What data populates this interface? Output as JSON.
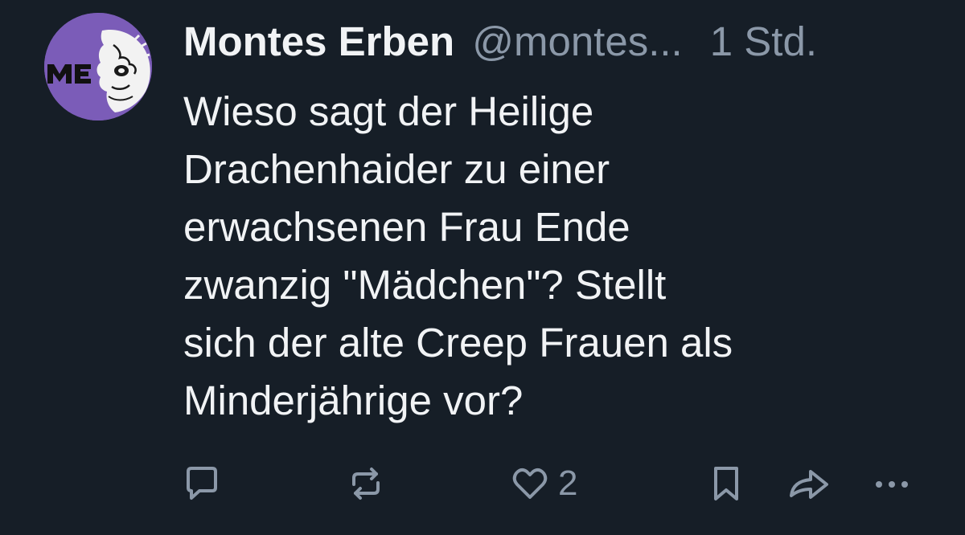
{
  "post": {
    "author": {
      "display_name": "Montes Erben",
      "handle": "@montes...",
      "avatar_text": "ME",
      "avatar_color": "#7b5cb8"
    },
    "timestamp": "1 Std.",
    "text": "Wieso sagt der Heilige\nDrachenhaider zu einer\nerwachsenen Frau Ende\nzwanzig \"Mädchen\"? Stellt\nsich der alte Creep Frauen als\nMinderjährige vor?",
    "actions": {
      "reply_icon": "speech-bubble-icon",
      "repost_icon": "repost-arrows-icon",
      "like_icon": "heart-outline-icon",
      "like_count": "2",
      "bookmark_icon": "bookmark-icon",
      "share_icon": "share-arrow-icon",
      "more_icon": "ellipsis-icon"
    }
  },
  "colors": {
    "background": "#161e27",
    "text_primary": "#f1f3f5",
    "text_secondary": "#8b98a8"
  }
}
